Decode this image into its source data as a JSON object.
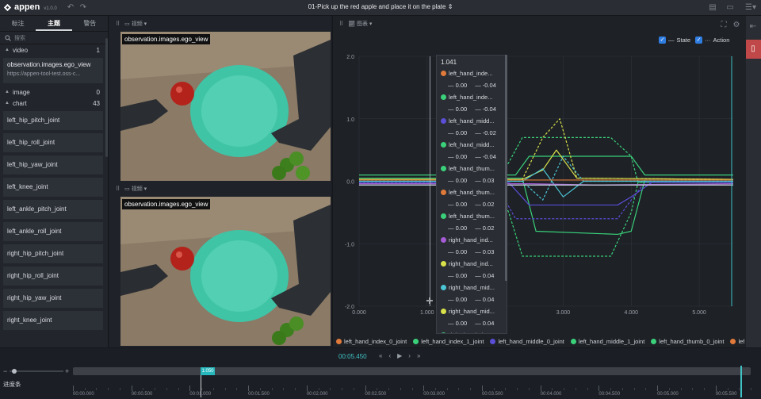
{
  "app": {
    "name": "appen",
    "version": "v1.0.0"
  },
  "task_title": "01-Pick up the red apple and place it on the plate",
  "left_panel": {
    "tabs": [
      {
        "label": "标注"
      },
      {
        "label": "主题",
        "active": true
      },
      {
        "label": "警告"
      }
    ],
    "search_placeholder": "搜索",
    "video_group": {
      "label": "video",
      "count": "1"
    },
    "video_item": {
      "title": "observation.images.ego_view",
      "url": "https://appen-tool-test.oss-c..."
    },
    "image_group": {
      "label": "image",
      "count": "0"
    },
    "chart_group": {
      "label": "chart",
      "count": "43"
    },
    "chart_items": [
      "left_hip_pitch_joint",
      "left_hip_roll_joint",
      "left_hip_yaw_joint",
      "left_knee_joint",
      "left_ankle_pitch_joint",
      "left_ankle_roll_joint",
      "right_hip_pitch_joint",
      "right_hip_roll_joint",
      "right_hip_yaw_joint",
      "right_knee_joint"
    ]
  },
  "video_panel": {
    "dropdown_label": "视频",
    "frames": [
      {
        "label": "observation.images.ego_view"
      },
      {
        "label": "observation.images.ego_view"
      }
    ]
  },
  "chart_panel": {
    "dropdown_label": "图表",
    "toggles": [
      {
        "label": "State",
        "checked": true
      },
      {
        "label": "Action",
        "checked": true
      }
    ],
    "tooltip": {
      "header": "1.041",
      "rows": [
        {
          "label": "left_hand_inde...",
          "color": "#e07a3a",
          "state": "0.00",
          "action": "-0.04"
        },
        {
          "label": "left_hand_inde...",
          "color": "#3ad17a",
          "state": "0.00",
          "action": "-0.04"
        },
        {
          "label": "left_hand_midd...",
          "color": "#5a4fd6",
          "state": "0.00",
          "action": "-0.02"
        },
        {
          "label": "left_hand_midd...",
          "color": "#3ad17a",
          "state": "0.00",
          "action": "-0.04"
        },
        {
          "label": "left_hand_thum...",
          "color": "#3ad17a",
          "state": "0.00",
          "action": "0.03"
        },
        {
          "label": "left_hand_thum...",
          "color": "#e07a3a",
          "state": "0.00",
          "action": "0.02"
        },
        {
          "label": "left_hand_thum...",
          "color": "#3ad17a",
          "state": "0.00",
          "action": "0.02"
        },
        {
          "label": "right_hand_ind...",
          "color": "#a65bd6",
          "state": "0.00",
          "action": "0.03"
        },
        {
          "label": "right_hand_ind...",
          "color": "#d8e04a",
          "state": "0.00",
          "action": "0.04"
        },
        {
          "label": "right_hand_mid...",
          "color": "#4ac6d6",
          "state": "0.00",
          "action": "0.04"
        },
        {
          "label": "right_hand_mid...",
          "color": "#d8e04a",
          "state": "0.00",
          "action": "0.04"
        },
        {
          "label": "right_hand_thu...",
          "color": "#3ad17a",
          "state": "",
          "action": ""
        }
      ]
    },
    "legend": [
      {
        "label": "left_hand_index_0_joint",
        "color": "#e07a3a"
      },
      {
        "label": "left_hand_index_1_joint",
        "color": "#3ad17a"
      },
      {
        "label": "left_hand_middle_0_joint",
        "color": "#5a4fd6"
      },
      {
        "label": "left_hand_middle_1_joint",
        "color": "#3ad17a"
      },
      {
        "label": "left_hand_thumb_0_joint",
        "color": "#3ad17a"
      },
      {
        "label": "left_",
        "color": "#e07a3a"
      }
    ]
  },
  "chart_data": {
    "type": "line",
    "xlim": [
      0,
      5.5
    ],
    "ylim": [
      -2.0,
      2.0
    ],
    "x_ticks": [
      "0.000",
      "1.000",
      "2.000",
      "3.000",
      "4.000",
      "5.000"
    ],
    "y_ticks": [
      "2.0",
      "1.0",
      "0.0",
      "-1.0",
      "-2.0"
    ],
    "cursor_x": 1.041,
    "series": [
      {
        "color": "#3ad17a",
        "style": "solid",
        "x": [
          0,
          2.2,
          2.4,
          2.6,
          3.8,
          4.0,
          4.2,
          5.5
        ],
        "y": [
          0.05,
          0.05,
          0.05,
          -0.8,
          -0.85,
          -0.8,
          0.02,
          0.02
        ]
      },
      {
        "color": "#3ad17a",
        "style": "solid",
        "x": [
          0,
          2.2,
          2.3,
          2.5,
          3.9,
          4.0,
          4.2,
          5.5
        ],
        "y": [
          0.1,
          0.1,
          0.1,
          0.4,
          0.4,
          0.4,
          0.1,
          0.1
        ]
      },
      {
        "color": "#3ad17a",
        "style": "dashed",
        "x": [
          0,
          2.0,
          2.2,
          2.4,
          3.7,
          4.0,
          4.1,
          5.5
        ],
        "y": [
          -0.02,
          -0.02,
          0.3,
          0.7,
          0.7,
          0.4,
          -0.02,
          -0.02
        ]
      },
      {
        "color": "#3ad17a",
        "style": "dashed",
        "x": [
          0,
          2.0,
          2.2,
          2.4,
          3.7,
          4.0,
          4.1,
          5.5
        ],
        "y": [
          -0.02,
          -0.02,
          -0.5,
          -1.2,
          -1.2,
          -0.5,
          -0.02,
          -0.02
        ]
      },
      {
        "color": "#5a4fd6",
        "style": "solid",
        "x": [
          0,
          2.2,
          2.5,
          3.8,
          4.0,
          4.3,
          5.5
        ],
        "y": [
          -0.02,
          -0.02,
          -0.38,
          -0.38,
          -0.25,
          -0.02,
          -0.02
        ]
      },
      {
        "color": "#5a4fd6",
        "style": "dashed",
        "x": [
          0,
          2.0,
          2.3,
          3.8,
          4.0,
          4.2,
          5.5
        ],
        "y": [
          -0.02,
          -0.02,
          -0.6,
          -0.6,
          -0.3,
          -0.02,
          -0.02
        ]
      },
      {
        "color": "#d8e04a",
        "style": "solid",
        "x": [
          0,
          2.4,
          2.7,
          2.9,
          3.2,
          5.5
        ],
        "y": [
          0.03,
          0.03,
          0.18,
          0.5,
          0.05,
          0.03
        ]
      },
      {
        "color": "#d8e04a",
        "style": "dashed",
        "x": [
          0,
          2.4,
          2.7,
          2.95,
          3.2,
          5.5
        ],
        "y": [
          0.03,
          0.03,
          0.7,
          1.0,
          0.05,
          0.03
        ]
      },
      {
        "color": "#4ac6d6",
        "style": "solid",
        "x": [
          0,
          2.4,
          2.7,
          3.0,
          3.3,
          5.5
        ],
        "y": [
          0.0,
          0.0,
          0.2,
          -0.25,
          0.0,
          0.0
        ]
      },
      {
        "color": "#4ac6d6",
        "style": "dashed",
        "x": [
          0,
          2.4,
          2.7,
          3.0,
          3.3,
          5.5
        ],
        "y": [
          0.0,
          0.0,
          -0.3,
          0.4,
          0.0,
          0.0
        ]
      },
      {
        "color": "#e07a3a",
        "style": "solid",
        "x": [
          0,
          5.5
        ],
        "y": [
          0.02,
          0.02
        ]
      },
      {
        "color": "#a65bd6",
        "style": "solid",
        "x": [
          0,
          2.5,
          3.5,
          5.5
        ],
        "y": [
          -0.04,
          -0.04,
          -0.06,
          -0.04
        ]
      },
      {
        "color": "#c9d4e0",
        "style": "solid",
        "x": [
          0,
          5.5
        ],
        "y": [
          -0.06,
          -0.06
        ]
      }
    ]
  },
  "playback": {
    "time": "00:05.450",
    "position_marker": "1.050",
    "progress_label": "进度条"
  },
  "ruler_ticks": [
    "00:00.000",
    "00:00.500",
    "00:01.000",
    "00:01.500",
    "00:02.000",
    "00:02.500",
    "00:03.000",
    "00:03.500",
    "00:04.000",
    "00:04.500",
    "00:05.000",
    "00:05.500"
  ]
}
